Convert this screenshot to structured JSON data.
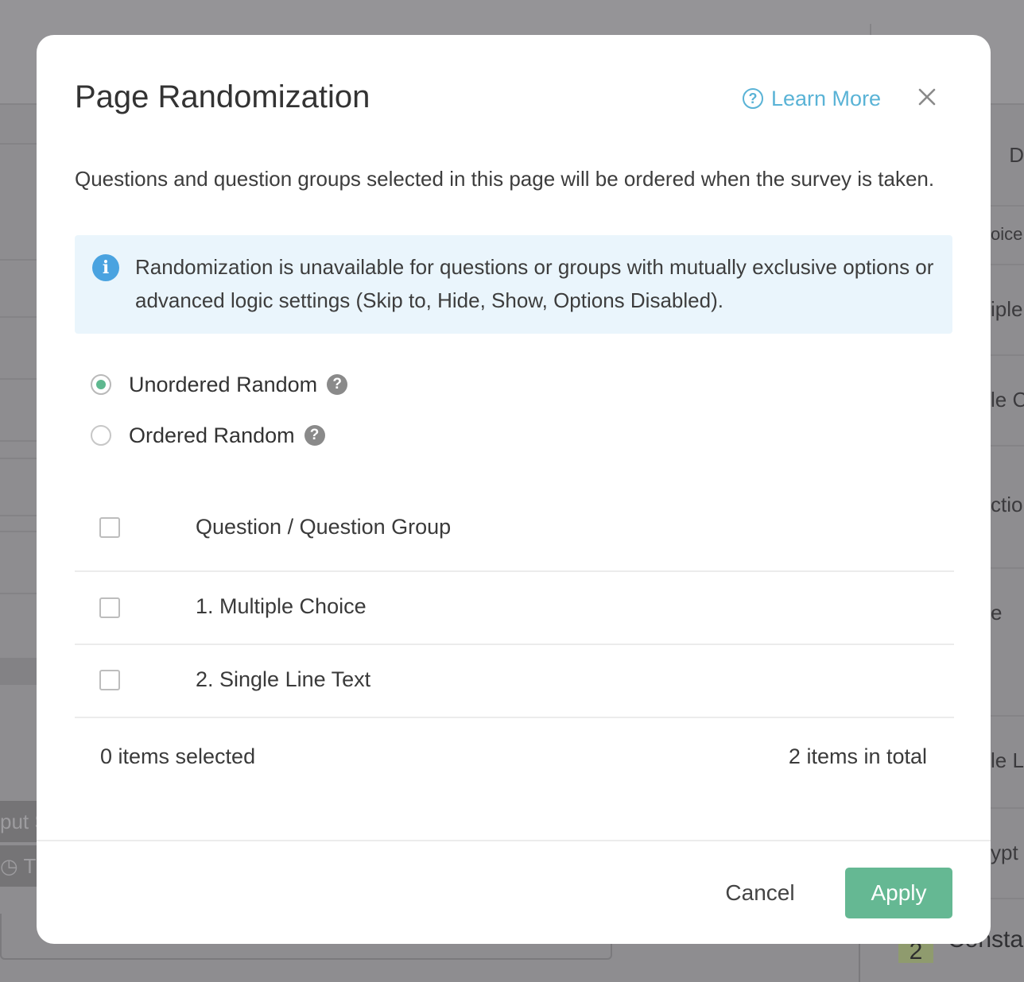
{
  "background": {
    "right_texts": [
      "D",
      "oice",
      "iple",
      "le C",
      "ctio",
      "e",
      "le L",
      "ypt"
    ],
    "chips": [
      "put S",
      "◷ Ti"
    ],
    "bottom_badge": "2",
    "bottom_text": "Constan"
  },
  "modal": {
    "title": "Page Randomization",
    "learn_more_label": "Learn More",
    "description": "Questions and question groups selected in this page will be ordered when the survey is taken.",
    "notice": "Randomization is unavailable for questions or groups with mutually exclusive options or advanced logic settings (Skip to, Hide, Show, Options Disabled).",
    "options": [
      {
        "label": "Unordered Random",
        "selected": true
      },
      {
        "label": "Ordered Random",
        "selected": false
      }
    ],
    "table": {
      "header": "Question / Question Group",
      "rows": [
        "1. Multiple Choice",
        "2. Single Line Text"
      ]
    },
    "selected_count_text": "0 items selected",
    "total_count_text": "2 items in total",
    "buttons": {
      "cancel": "Cancel",
      "apply": "Apply"
    }
  },
  "colors": {
    "accent_green": "#65b893",
    "link_blue": "#5ab3d6",
    "info_blue": "#4aa3e0",
    "notice_bg": "#eaf5fc",
    "overlay": "#8e8d90"
  },
  "icons": {
    "learn_more": "help-circle-icon",
    "close": "close-icon",
    "notice": "info-icon",
    "option_help": "question-icon"
  }
}
